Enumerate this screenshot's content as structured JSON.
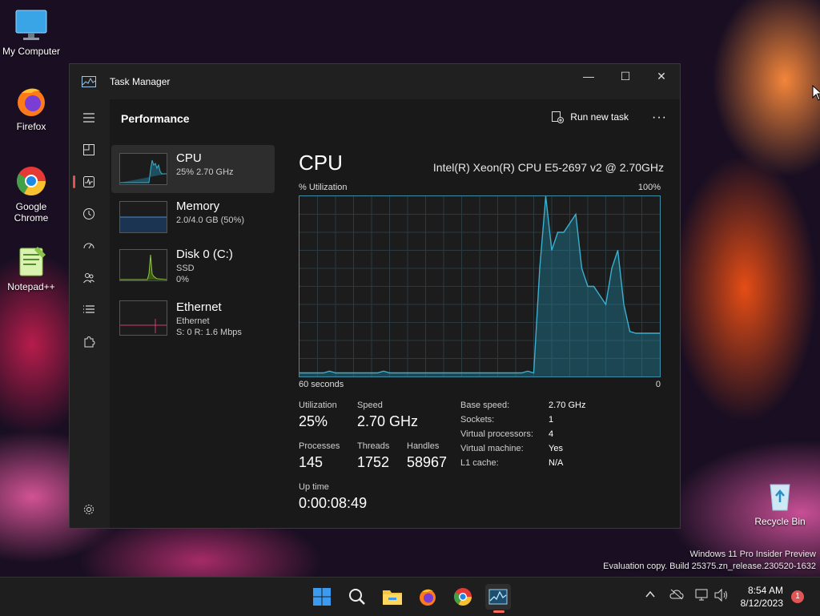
{
  "desktop": {
    "icons": [
      {
        "label": "My Computer"
      },
      {
        "label": "Firefox"
      },
      {
        "label": "Google Chrome"
      },
      {
        "label": "Notepad++"
      },
      {
        "label": "Recycle Bin"
      }
    ],
    "watermark": {
      "line1": "Windows 11 Pro Insider Preview",
      "line2": "Evaluation copy. Build 25375.zn_release.230520-1632"
    }
  },
  "window": {
    "title": "Task Manager",
    "controls": {
      "minimize": "—",
      "maximize": "☐",
      "close": "✕"
    },
    "nav": [
      "hamburger-menu",
      "processes",
      "performance",
      "app-history",
      "startup-apps",
      "users",
      "details",
      "services",
      "settings"
    ],
    "header": {
      "page_title": "Performance",
      "run_new_task": "Run new task",
      "more": "···"
    },
    "devices": [
      {
        "name": "CPU",
        "line1": "25% 2.70 GHz",
        "line2": "",
        "selected": true
      },
      {
        "name": "Memory",
        "line1": "2.0/4.0 GB (50%)",
        "line2": ""
      },
      {
        "name": "Disk 0 (C:)",
        "line1": "SSD",
        "line2": "0%"
      },
      {
        "name": "Ethernet",
        "line1": "Ethernet",
        "line2": "S: 0 R: 1.6 Mbps"
      }
    ],
    "cpu": {
      "heading": "CPU",
      "model": "Intel(R) Xeon(R) CPU E5-2697 v2 @ 2.70GHz",
      "graph_label_left": "% Utilization",
      "graph_label_right": "100%",
      "axis_left": "60 seconds",
      "axis_right": "0",
      "stats": {
        "utilization_label": "Utilization",
        "utilization": "25%",
        "speed_label": "Speed",
        "speed": "2.70 GHz",
        "processes_label": "Processes",
        "processes": "145",
        "threads_label": "Threads",
        "threads": "1752",
        "handles_label": "Handles",
        "handles": "58967",
        "uptime_label": "Up time",
        "uptime": "0:00:08:49"
      },
      "specs": [
        {
          "k": "Base speed:",
          "v": "2.70 GHz"
        },
        {
          "k": "Sockets:",
          "v": "1"
        },
        {
          "k": "Virtual processors:",
          "v": "4"
        },
        {
          "k": "Virtual machine:",
          "v": "Yes"
        },
        {
          "k": "L1 cache:",
          "v": "N/A"
        }
      ]
    }
  },
  "chart_data": {
    "type": "area",
    "title": "",
    "xlabel": "",
    "ylabel": "% Utilization",
    "ylim": [
      0,
      100
    ],
    "x": [
      0,
      1,
      2,
      3,
      4,
      5,
      6,
      7,
      8,
      9,
      10,
      11,
      12,
      13,
      14,
      15,
      16,
      17,
      18,
      19,
      20,
      21,
      22,
      23,
      24,
      25,
      26,
      27,
      28,
      29,
      30,
      31,
      32,
      33,
      34,
      35,
      36,
      37,
      38,
      39,
      40,
      41,
      42,
      43,
      44,
      45,
      46,
      47,
      48,
      49,
      50,
      51,
      52,
      53,
      54,
      55,
      56,
      57,
      58,
      59,
      60
    ],
    "series": [
      {
        "values": [
          2,
          2,
          2,
          2,
          2,
          3,
          2,
          2,
          2,
          2,
          2,
          2,
          2,
          2,
          3,
          2,
          2,
          2,
          2,
          2,
          2,
          2,
          2,
          2,
          2,
          2,
          2,
          2,
          2,
          2,
          2,
          2,
          2,
          2,
          2,
          2,
          2,
          2,
          3,
          2,
          60,
          100,
          70,
          80,
          80,
          85,
          90,
          60,
          50,
          50,
          45,
          40,
          60,
          70,
          40,
          25,
          24,
          24,
          24,
          24,
          24
        ]
      }
    ],
    "color": "#1e94b4"
  },
  "taskbar": {
    "items": [
      "start-icon",
      "search-icon",
      "file-explorer-icon",
      "firefox-icon",
      "chrome-icon",
      "task-manager-icon"
    ],
    "clock_time": "8:54 AM",
    "clock_date": "8/12/2023",
    "notification_count": "1"
  }
}
